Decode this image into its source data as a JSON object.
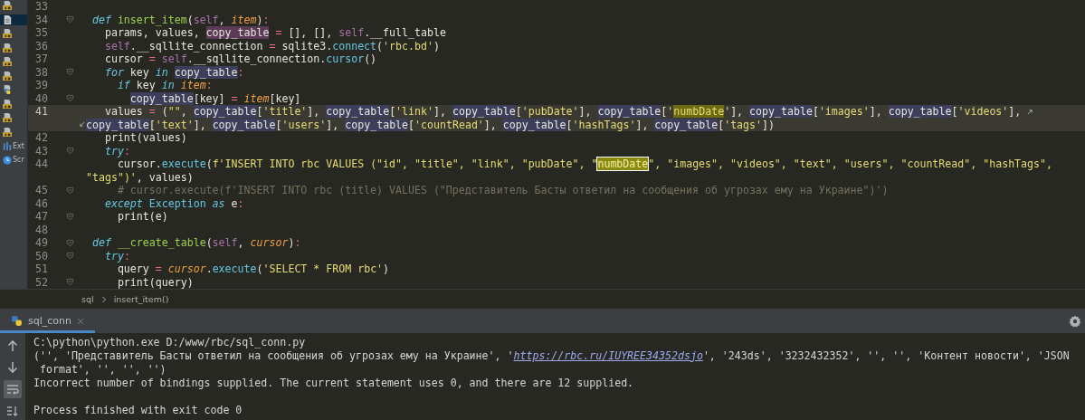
{
  "sidebar": {
    "items": [
      {
        "kind": "js",
        "selected": false
      },
      {
        "kind": "doc",
        "selected": true
      },
      {
        "kind": "js",
        "selected": false
      },
      {
        "kind": "js",
        "selected": false
      },
      {
        "kind": "js",
        "selected": false
      },
      {
        "kind": "js",
        "selected": false
      },
      {
        "kind": "python",
        "selected": false
      },
      {
        "kind": "js",
        "selected": false
      },
      {
        "kind": "js",
        "selected": false
      },
      {
        "kind": "js",
        "selected": false
      },
      {
        "kind": "chart",
        "selected": false,
        "label": "Ext"
      },
      {
        "kind": "clock",
        "selected": false,
        "label": "Scr"
      }
    ]
  },
  "editor": {
    "rows": [
      {
        "number": "33",
        "fold": false,
        "current": false,
        "wrap_mark": false
      },
      {
        "number": "34",
        "fold": true,
        "current": false,
        "wrap_mark": false,
        "tokens": [
          {
            "kind": "keyword",
            "text": "  def "
          },
          {
            "kind": "function",
            "text": "insert_item"
          },
          {
            "kind": "plain",
            "text": "("
          },
          {
            "kind": "self",
            "text": "self"
          },
          {
            "kind": "plain",
            "text": ", "
          },
          {
            "kind": "param",
            "text": "item"
          },
          {
            "kind": "plain",
            "text": ")"
          },
          {
            "kind": "operator",
            "text": ":"
          }
        ]
      },
      {
        "number": "35",
        "fold": false,
        "current": false,
        "wrap_mark": false,
        "tokens": [
          {
            "kind": "plain",
            "text": "    params, values, "
          },
          {
            "kind": "write",
            "text": "copy_table"
          },
          {
            "kind": "operator",
            "text": " ="
          },
          {
            "kind": "plain",
            "text": " [], [], "
          },
          {
            "kind": "self",
            "text": "self"
          },
          {
            "kind": "plain",
            "text": ".__full_table"
          }
        ]
      },
      {
        "number": "36",
        "fold": false,
        "current": false,
        "wrap_mark": false,
        "tokens": [
          {
            "kind": "self",
            "text": "    self"
          },
          {
            "kind": "plain",
            "text": ".__sqllite_connection "
          },
          {
            "kind": "operator",
            "text": "="
          },
          {
            "kind": "plain",
            "text": " sqlite3."
          },
          {
            "kind": "method",
            "text": "connect"
          },
          {
            "kind": "plain",
            "text": "("
          },
          {
            "kind": "string",
            "text": "'rbc.bd'"
          },
          {
            "kind": "plain",
            "text": ")"
          }
        ]
      },
      {
        "number": "37",
        "fold": false,
        "current": false,
        "wrap_mark": false,
        "tokens": [
          {
            "kind": "plain",
            "text": "    cursor "
          },
          {
            "kind": "operator",
            "text": "="
          },
          {
            "kind": "self",
            "text": " self"
          },
          {
            "kind": "plain",
            "text": ".__sqllite_connection."
          },
          {
            "kind": "method",
            "text": "cursor"
          },
          {
            "kind": "plain",
            "text": "()"
          }
        ]
      },
      {
        "number": "38",
        "fold": true,
        "current": false,
        "wrap_mark": false,
        "tokens": [
          {
            "kind": "keyword",
            "text": "    for"
          },
          {
            "kind": "plain",
            "text": " key "
          },
          {
            "kind": "keyword",
            "text": "in"
          },
          {
            "kind": "read",
            "text": " copy_table"
          },
          {
            "kind": "operator",
            "text": ":"
          }
        ]
      },
      {
        "number": "39",
        "fold": false,
        "current": false,
        "wrap_mark": false,
        "tokens": [
          {
            "kind": "keyword",
            "text": "      if"
          },
          {
            "kind": "plain",
            "text": " key "
          },
          {
            "kind": "keyword",
            "text": "in"
          },
          {
            "kind": "param",
            "text": " item"
          },
          {
            "kind": "operator",
            "text": ":"
          }
        ]
      },
      {
        "number": "40",
        "fold": true,
        "current": false,
        "wrap_mark": false,
        "tokens": [
          {
            "kind": "read",
            "text": "        copy_table"
          },
          {
            "kind": "plain",
            "text": "[key] "
          },
          {
            "kind": "operator",
            "text": "="
          },
          {
            "kind": "param",
            "text": " item"
          },
          {
            "kind": "plain",
            "text": "[key]"
          }
        ]
      },
      {
        "number": "41",
        "fold": false,
        "current": true,
        "wrap_mark": true,
        "tokens": [
          {
            "kind": "plain",
            "text": "    values "
          },
          {
            "kind": "operator",
            "text": "="
          },
          {
            "kind": "plain",
            "text": " ("
          },
          {
            "kind": "string",
            "text": "\"\""
          },
          {
            "kind": "plain",
            "text": ", "
          },
          {
            "kind": "read",
            "text": "copy_table"
          },
          {
            "kind": "plain",
            "text": "["
          },
          {
            "kind": "string",
            "text": "'title'"
          },
          {
            "kind": "plain",
            "text": "], "
          },
          {
            "kind": "read",
            "text": "copy_table"
          },
          {
            "kind": "plain",
            "text": "["
          },
          {
            "kind": "string",
            "text": "'link'"
          },
          {
            "kind": "plain",
            "text": "], "
          },
          {
            "kind": "read",
            "text": "copy_table"
          },
          {
            "kind": "plain",
            "text": "["
          },
          {
            "kind": "string",
            "text": "'pubDate'"
          },
          {
            "kind": "plain",
            "text": "], "
          },
          {
            "kind": "read",
            "text": "copy_table"
          },
          {
            "kind": "plain",
            "text": "["
          },
          {
            "kind": "string",
            "text": "'"
          },
          {
            "kind": "match",
            "text": "numbDate"
          },
          {
            "kind": "string",
            "text": "'"
          },
          {
            "kind": "plain",
            "text": "], "
          },
          {
            "kind": "read",
            "text": "copy_table"
          },
          {
            "kind": "plain",
            "text": "["
          },
          {
            "kind": "string",
            "text": "'images'"
          },
          {
            "kind": "plain",
            "text": "], "
          },
          {
            "kind": "read",
            "text": "copy_table"
          },
          {
            "kind": "plain",
            "text": "["
          },
          {
            "kind": "string",
            "text": "'videos'"
          },
          {
            "kind": "plain",
            "text": "],"
          }
        ]
      },
      {
        "current": true,
        "wrap_mark": true,
        "tokens": [
          {
            "kind": "read",
            "text": "copy_table"
          },
          {
            "kind": "plain",
            "text": "["
          },
          {
            "kind": "string",
            "text": "'text'"
          },
          {
            "kind": "plain",
            "text": "], "
          },
          {
            "kind": "read",
            "text": "copy_table"
          },
          {
            "kind": "plain",
            "text": "["
          },
          {
            "kind": "string",
            "text": "'users'"
          },
          {
            "kind": "plain",
            "text": "], "
          },
          {
            "kind": "read",
            "text": "copy_table"
          },
          {
            "kind": "plain",
            "text": "["
          },
          {
            "kind": "string",
            "text": "'countRead'"
          },
          {
            "kind": "plain",
            "text": "], "
          },
          {
            "kind": "read",
            "text": "copy_table"
          },
          {
            "kind": "plain",
            "text": "["
          },
          {
            "kind": "string",
            "text": "'hashTags'"
          },
          {
            "kind": "plain",
            "text": "], "
          },
          {
            "kind": "read",
            "text": "copy_table"
          },
          {
            "kind": "plain",
            "text": "["
          },
          {
            "kind": "string",
            "text": "'tags'"
          },
          {
            "kind": "plain",
            "text": "])"
          }
        ]
      },
      {
        "number": "42",
        "fold": false,
        "current": false,
        "wrap_mark": false,
        "tokens": [
          {
            "kind": "plain",
            "text": "    print(values)"
          }
        ]
      },
      {
        "number": "43",
        "fold": true,
        "current": false,
        "wrap_mark": false,
        "tokens": [
          {
            "kind": "keyword",
            "text": "    try"
          },
          {
            "kind": "operator",
            "text": ":"
          }
        ]
      },
      {
        "number": "44",
        "fold": false,
        "current": false,
        "wrap_mark": false,
        "tokens": [
          {
            "kind": "plain",
            "text": "      cursor."
          },
          {
            "kind": "method",
            "text": "execute"
          },
          {
            "kind": "plain",
            "text": "("
          },
          {
            "kind": "string",
            "text": "f'INSERT INTO rbc VALUES (\"id\", \"title\", \"link\", \"pubDate\", \""
          },
          {
            "kind": "found",
            "text": "numbDate"
          },
          {
            "kind": "string",
            "text": "\", \"images\", \"videos\", \"text\", \"users\", \"countRead\", \"hashTags\","
          }
        ]
      },
      {
        "current": false,
        "wrap_mark": false,
        "tokens": [
          {
            "kind": "string",
            "text": "\"tags\")'"
          },
          {
            "kind": "plain",
            "text": ", values)"
          }
        ]
      },
      {
        "number": "45",
        "fold": true,
        "current": false,
        "wrap_mark": false,
        "tokens": [
          {
            "kind": "comment",
            "text": "      # cursor.execute(f'INSERT INTO rbc (title) VALUES (\"Представитель Басты ответил на сообщения об угрозах ему на Украине\")')"
          }
        ]
      },
      {
        "number": "46",
        "fold": false,
        "current": false,
        "wrap_mark": false,
        "tokens": [
          {
            "kind": "keyword",
            "text": "    except"
          },
          {
            "kind": "class",
            "text": " Exception"
          },
          {
            "kind": "keyword",
            "text": " as"
          },
          {
            "kind": "plain",
            "text": " e"
          },
          {
            "kind": "operator",
            "text": ":"
          }
        ]
      },
      {
        "number": "47",
        "fold": true,
        "current": false,
        "wrap_mark": false,
        "tokens": [
          {
            "kind": "plain",
            "text": "      print(e)"
          }
        ]
      },
      {
        "number": "48",
        "fold": false,
        "current": false,
        "wrap_mark": false
      },
      {
        "number": "49",
        "fold": true,
        "current": false,
        "wrap_mark": false,
        "tokens": [
          {
            "kind": "keyword",
            "text": "  def "
          },
          {
            "kind": "function",
            "text": "__create_table"
          },
          {
            "kind": "plain",
            "text": "("
          },
          {
            "kind": "self",
            "text": "self"
          },
          {
            "kind": "plain",
            "text": ", "
          },
          {
            "kind": "param",
            "text": "cursor"
          },
          {
            "kind": "plain",
            "text": ")"
          },
          {
            "kind": "operator",
            "text": ":"
          }
        ]
      },
      {
        "number": "50",
        "fold": true,
        "current": false,
        "wrap_mark": false,
        "tokens": [
          {
            "kind": "keyword",
            "text": "    try"
          },
          {
            "kind": "operator",
            "text": ":"
          }
        ]
      },
      {
        "number": "51",
        "fold": false,
        "current": false,
        "wrap_mark": false,
        "tokens": [
          {
            "kind": "plain",
            "text": "      query "
          },
          {
            "kind": "operator",
            "text": "="
          },
          {
            "kind": "param",
            "text": " cursor"
          },
          {
            "kind": "plain",
            "text": "."
          },
          {
            "kind": "method",
            "text": "execute"
          },
          {
            "kind": "plain",
            "text": "("
          },
          {
            "kind": "string",
            "text": "'SELECT * FROM rbc'"
          },
          {
            "kind": "plain",
            "text": ")"
          }
        ]
      },
      {
        "number": "52",
        "fold": true,
        "current": false,
        "wrap_mark": false,
        "tokens": [
          {
            "kind": "plain",
            "text": "      print(query)"
          }
        ]
      }
    ]
  },
  "breadcrumb": [
    "sql",
    "insert_item()"
  ],
  "run_panel": {
    "tab": {
      "label": "sql_conn",
      "selected": true
    },
    "tools": [
      {
        "kind": "up",
        "selected": false
      },
      {
        "kind": "down",
        "selected": false
      },
      {
        "kind": "wrap",
        "selected": true
      },
      {
        "kind": "sort",
        "selected": false
      }
    ],
    "output": [
      [
        {
          "kind": "plain",
          "text": "C:\\python\\python.exe D:/www/rbc/sql_conn.py"
        }
      ],
      [
        {
          "kind": "plain",
          "text": "('', 'Представитель Басты ответил на сообщения об угрозах ему на Украине', '"
        },
        {
          "kind": "link",
          "text": "https://rbc.ru/IUYREE34352dsjo"
        },
        {
          "kind": "plain",
          "text": "', '243ds', '3232432352', '', '', 'Контент новости', 'JSON"
        }
      ],
      [
        {
          "kind": "plain",
          "text": " format', '', '', '')"
        }
      ],
      [
        {
          "kind": "plain",
          "text": "Incorrect number of bindings supplied. The current statement uses 0, and there are 12 supplied."
        }
      ]
    ],
    "exit_message": "Process finished with exit code 0"
  }
}
